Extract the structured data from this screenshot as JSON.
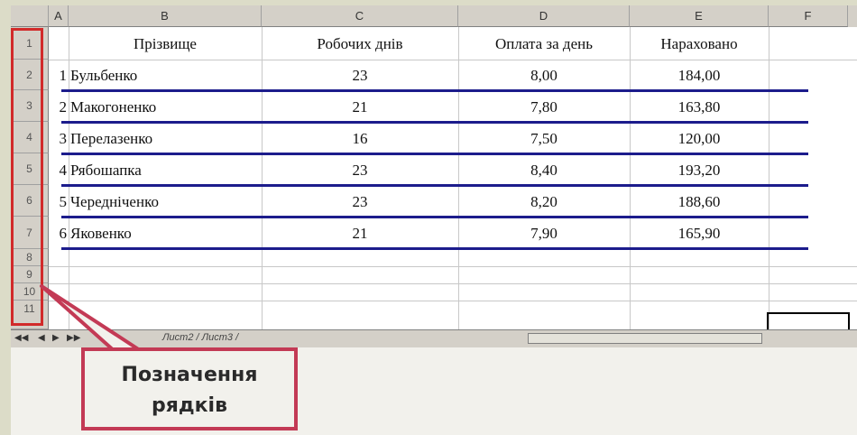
{
  "columns": [
    "A",
    "B",
    "C",
    "D",
    "E",
    "F"
  ],
  "row_numbers": [
    "1",
    "2",
    "3",
    "4",
    "5",
    "6",
    "7",
    "8",
    "9",
    "10",
    "11"
  ],
  "header": {
    "surname": "Прізвище",
    "work_days": "Робочих днів",
    "pay_per_day": "Оплата за день",
    "accrued": "Нараховано"
  },
  "rows": [
    {
      "num": "1",
      "surname": "Бульбенко",
      "days": "23",
      "pay": "8,00",
      "accrued": "184,00"
    },
    {
      "num": "2",
      "surname": "Макогоненко",
      "days": "21",
      "pay": "7,80",
      "accrued": "163,80"
    },
    {
      "num": "3",
      "surname": "Перелазенко",
      "days": "16",
      "pay": "7,50",
      "accrued": "120,00"
    },
    {
      "num": "4",
      "surname": "Рябошапка",
      "days": "23",
      "pay": "8,40",
      "accrued": "193,20"
    },
    {
      "num": "5",
      "surname": "Чередніченко",
      "days": "23",
      "pay": "8,20",
      "accrued": "188,60"
    },
    {
      "num": "6",
      "surname": "Яковенко",
      "days": "21",
      "pay": "7,90",
      "accrued": "165,90"
    }
  ],
  "sheet_tabs": "Лист2 / Лист3 /",
  "callout": {
    "line1": "Позначення",
    "line2": "рядків"
  },
  "colors": {
    "underline": "#1c1c8c",
    "highlight": "#d12a2a",
    "callout_border": "#c33a55"
  }
}
